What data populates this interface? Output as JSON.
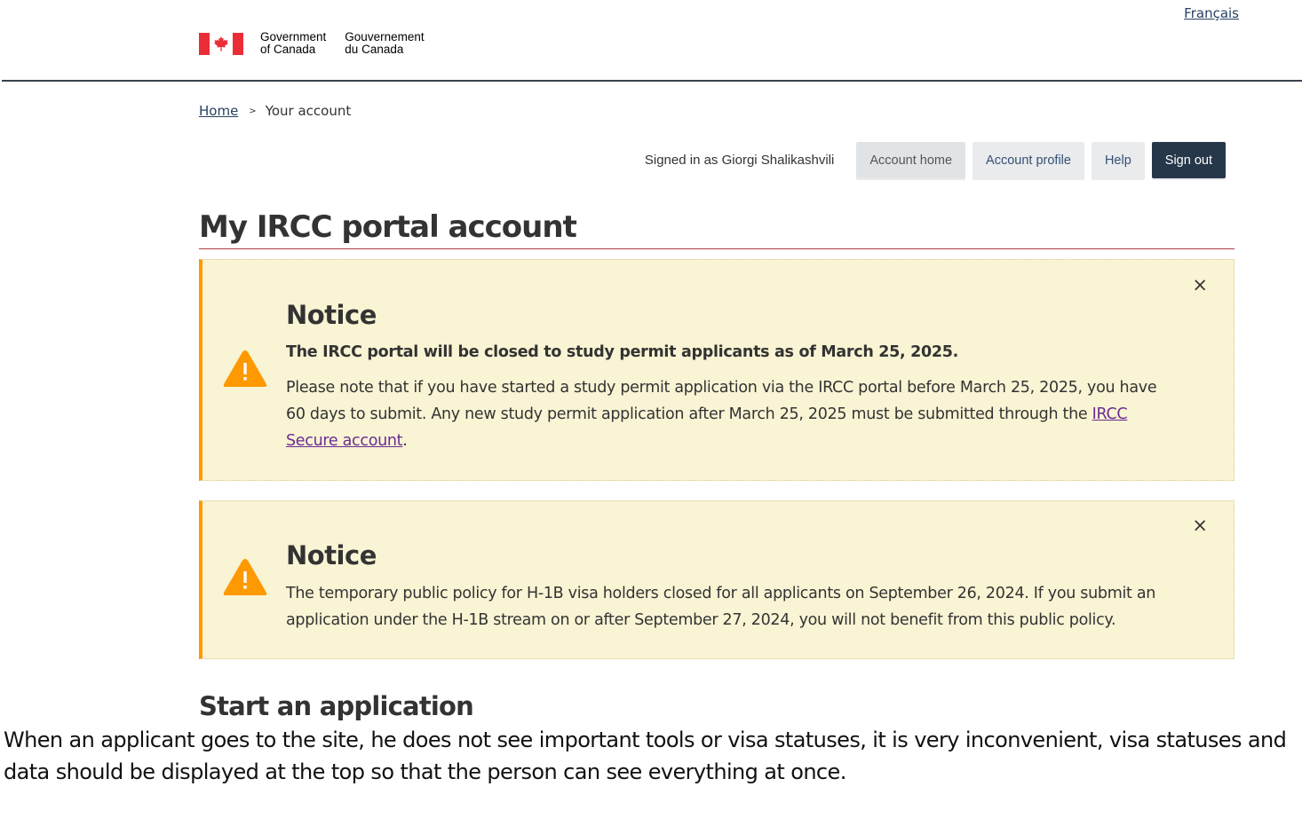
{
  "header": {
    "language_link": "Français",
    "fip": {
      "en_line1": "Government",
      "en_line2": "of Canada",
      "fr_line1": "Gouvernement",
      "fr_line2": "du Canada"
    }
  },
  "breadcrumb": {
    "home": "Home",
    "current": "Your account"
  },
  "account_bar": {
    "signed_in": "Signed in as Giorgi Shalikashvili",
    "account_home": "Account home",
    "account_profile": "Account profile",
    "help": "Help",
    "sign_out": "Sign out"
  },
  "page_title": "My IRCC portal account",
  "notices": [
    {
      "title": "Notice",
      "lead": "The IRCC portal will be closed to study permit applicants as of March 25, 2025.",
      "body_before": "Please note that if you have started a study permit application via the IRCC portal before March 25, 2025, you have 60 days to submit. Any new study permit application after March 25, 2025 must be submitted through the ",
      "link": "IRCC Secure account",
      "body_after": "."
    },
    {
      "title": "Notice",
      "body": "The temporary public policy for H-1B visa holders closed for all applicants on September 26, 2024. If you submit an application under the H-1B stream on or after September 27, 2024, you will not benefit from this public policy."
    }
  ],
  "close_symbol": "×",
  "breadcrumb_separator": ">",
  "section_title": "Start an application",
  "annotation": "When an applicant goes to the site, he does not see important tools or visa statuses, it is very inconvenient, visa statuses and data should be displayed at the top so that the person can see everything at once.",
  "colors": {
    "flag_red": "#eb2d37",
    "alert_bg": "#f9f4d4",
    "alert_border": "#ff9900",
    "sign_out_bg": "#26374a",
    "title_rule": "#af3c43"
  },
  "icons": {
    "warning": "warning-triangle-icon",
    "close": "close-icon",
    "maple_leaf": "maple-leaf-icon"
  }
}
